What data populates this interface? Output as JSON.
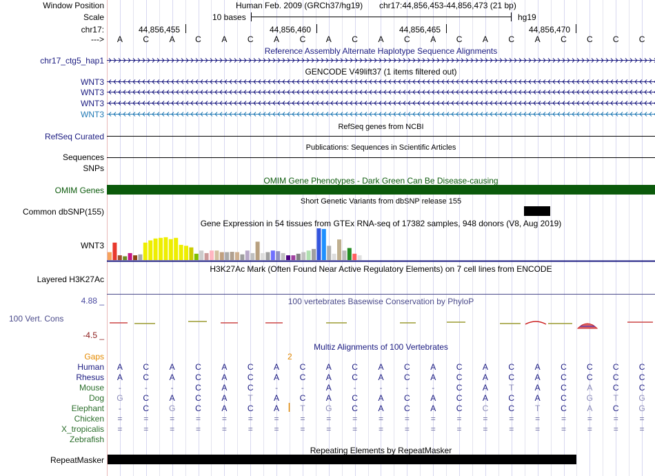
{
  "header": {
    "window_position_label": "Window Position",
    "scale_label": "Scale",
    "chrom_label": "chr17:",
    "arrow_label": "--->",
    "assembly": "Human Feb. 2009 (GRCh37/hg19)",
    "position": "chr17:44,856,453-44,856,473 (21 bp)",
    "scale_text": "10 bases",
    "db": "hg19",
    "coordinates": [
      "44,856,455",
      "44,856,460",
      "44,856,465",
      "44,856,470"
    ]
  },
  "bases": [
    "A",
    "C",
    "A",
    "C",
    "A",
    "C",
    "A",
    "C",
    "A",
    "C",
    "A",
    "C",
    "A",
    "C",
    "A",
    "C",
    "A",
    "C",
    "C",
    "C",
    "C"
  ],
  "tracks": {
    "alt_hap": {
      "title": "Reference Assembly Alternate Haplotype Sequence Alignments",
      "label": "chr17_ctg5_hap1"
    },
    "gencode": {
      "title": "GENCODE V49lift37 (1 items filtered out)",
      "labels": [
        "WNT3",
        "WNT3",
        "WNT3",
        "WNT3"
      ]
    },
    "refseq": {
      "title": "RefSeq genes from NCBI",
      "label": "RefSeq Curated"
    },
    "publications": {
      "title": "Publications: Sequences in Scientific Articles",
      "label": "Sequences"
    },
    "snps_label": "SNPs",
    "omim": {
      "title": "OMIM Gene Phenotypes - Dark Green Can Be Disease-causing",
      "label": "OMIM Genes",
      "color": "#0b5a0b"
    },
    "dbsnp": {
      "title": "Short Genetic Variants from dbSNP release 155",
      "label": "Common dbSNP(155)"
    },
    "gtex": {
      "title": "Gene Expression in 54 tissues from GTEx RNA-seq of 17382 samples, 948 donors (V8, Aug 2019)",
      "label": "WNT3"
    },
    "h3k27ac": {
      "title": "H3K27Ac Mark (Often Found Near Active Regulatory Elements) on 7 cell lines from ENCODE",
      "label": "Layered H3K27Ac"
    },
    "conservation": {
      "title": "100 vertebrates Basewise Conservation by PhyloP",
      "label": "100 Vert. Cons",
      "max": "4.88 _",
      "min": "-4.5 _"
    },
    "multiz": {
      "title": "Multiz Alignments of 100 Vertebrates",
      "gaps_label": "Gaps",
      "gap_count": "2",
      "species": [
        {
          "name": "Human",
          "seq": [
            "A",
            "C",
            "A",
            "C",
            "A",
            "C",
            "A",
            "C",
            "A",
            "C",
            "A",
            "C",
            "A",
            "C",
            "A",
            "C",
            "A",
            "C",
            "C",
            "C",
            "C"
          ]
        },
        {
          "name": "Rhesus",
          "seq": [
            "A",
            "C",
            "A",
            "C",
            "A",
            "C",
            "A",
            "C",
            "A",
            "C",
            "A",
            "C",
            "A",
            "C",
            "A",
            "C",
            "A",
            "C",
            "C",
            "C",
            "C"
          ]
        },
        {
          "name": "Mouse",
          "seq": [
            "-",
            "-",
            "-",
            "C",
            "A",
            "C",
            "-",
            "-",
            "A",
            "-",
            "-",
            "-",
            "-",
            "C",
            "A",
            "T",
            "A",
            "C",
            "A",
            "C",
            "C"
          ]
        },
        {
          "name": "Dog",
          "seq": [
            "G",
            "C",
            "A",
            "C",
            "A",
            "T",
            "A",
            "C",
            "A",
            "C",
            "A",
            "C",
            "A",
            "C",
            "A",
            "C",
            "A",
            "C",
            "G",
            "T",
            "G"
          ]
        },
        {
          "name": "Elephant",
          "seq": [
            "-",
            "C",
            "G",
            "C",
            "A",
            "C",
            "A",
            "T",
            "G",
            "C",
            "A",
            "C",
            "A",
            "C",
            "C",
            "C",
            "T",
            "C",
            "A",
            "C",
            "G"
          ]
        },
        {
          "name": "Chicken",
          "seq": [
            "=",
            "=",
            "=",
            "=",
            "=",
            "=",
            "=",
            "=",
            "=",
            "=",
            "=",
            "=",
            "=",
            "=",
            "=",
            "=",
            "=",
            "=",
            "=",
            "=",
            "="
          ]
        },
        {
          "name": "X_tropicalis",
          "seq": [
            "=",
            "=",
            "=",
            "=",
            "=",
            "=",
            "=",
            "=",
            "=",
            "=",
            "=",
            "=",
            "=",
            "=",
            "=",
            "=",
            "=",
            "=",
            "=",
            "=",
            "="
          ]
        },
        {
          "name": "Zebrafish",
          "seq": []
        }
      ]
    },
    "repeatmasker": {
      "title": "Repeating Elements by RepeatMasker",
      "label": "RepeatMasker"
    }
  },
  "gtex_bars": [
    {
      "level": 0.25,
      "color": "#f7a35c"
    },
    {
      "level": 0.55,
      "color": "#e8382d"
    },
    {
      "level": 0.15,
      "color": "#a0522d"
    },
    {
      "level": 0.12,
      "color": "#6b8e23"
    },
    {
      "level": 0.22,
      "color": "#c71585"
    },
    {
      "level": 0.15,
      "color": "#8b4513"
    },
    {
      "level": 0.18,
      "color": "#a9a9a9"
    },
    {
      "level": 0.55,
      "color": "#eeee00"
    },
    {
      "level": 0.62,
      "color": "#eeee00"
    },
    {
      "level": 0.68,
      "color": "#eeee00"
    },
    {
      "level": 0.7,
      "color": "#eeee00"
    },
    {
      "level": 0.72,
      "color": "#eeee00"
    },
    {
      "level": 0.66,
      "color": "#eeee00"
    },
    {
      "level": 0.7,
      "color": "#eeee00"
    },
    {
      "level": 0.48,
      "color": "#eeee00"
    },
    {
      "level": 0.45,
      "color": "#eeee00"
    },
    {
      "level": 0.4,
      "color": "#cccc00"
    },
    {
      "level": 0.2,
      "color": "#7fbf00"
    },
    {
      "level": 0.3,
      "color": "#cccccc"
    },
    {
      "level": 0.22,
      "color": "#cc9999"
    },
    {
      "level": 0.3,
      "color": "#ffb6c1"
    },
    {
      "level": 0.3,
      "color": "#d3c0a0"
    },
    {
      "level": 0.25,
      "color": "#c0a080"
    },
    {
      "level": 0.25,
      "color": "#aaaaaa"
    },
    {
      "level": 0.26,
      "color": "#b0a090"
    },
    {
      "level": 0.25,
      "color": "#cfb090"
    },
    {
      "level": 0.18,
      "color": "#9e9e9e"
    },
    {
      "level": 0.3,
      "color": "#b8a8c8"
    },
    {
      "level": 0.22,
      "color": "#bfbfbf"
    },
    {
      "level": 0.58,
      "color": "#b8a080"
    },
    {
      "level": 0.22,
      "color": "#dddddd"
    },
    {
      "level": 0.25,
      "color": "#a0a0a0"
    },
    {
      "level": 0.3,
      "color": "#7070ff"
    },
    {
      "level": 0.28,
      "color": "#9090c0"
    },
    {
      "level": 0.22,
      "color": "#c0c0c0"
    },
    {
      "level": 0.15,
      "color": "#4b0082"
    },
    {
      "level": 0.15,
      "color": "#a040a0"
    },
    {
      "level": 0.2,
      "color": "#808080"
    },
    {
      "level": 0.25,
      "color": "#c0c0c0"
    },
    {
      "level": 0.3,
      "color": "#b0e0b0"
    },
    {
      "level": 0.35,
      "color": "#a0a0a0"
    },
    {
      "level": 1.0,
      "color": "#3355dd"
    },
    {
      "level": 0.98,
      "color": "#1e90ff"
    },
    {
      "level": 0.45,
      "color": "#b0b0b0"
    },
    {
      "level": 0.2,
      "color": "#dddddd"
    },
    {
      "level": 0.65,
      "color": "#c0b090"
    },
    {
      "level": 0.3,
      "color": "#bbbbbb"
    },
    {
      "level": 0.38,
      "color": "#228b22"
    },
    {
      "level": 0.2,
      "color": "#ff6060"
    },
    {
      "level": 0.15,
      "color": "#e0e0e0"
    }
  ],
  "colors": {
    "navy": "#1a1a80",
    "omim": "#0b5a0b",
    "gaps": "#e58a00",
    "species": "#2a6d2a",
    "track_blue": "#1f78b4",
    "conservation": "#4a4a8a",
    "max_label": "#4a4aa0",
    "min_label": "#8b1a1a"
  }
}
